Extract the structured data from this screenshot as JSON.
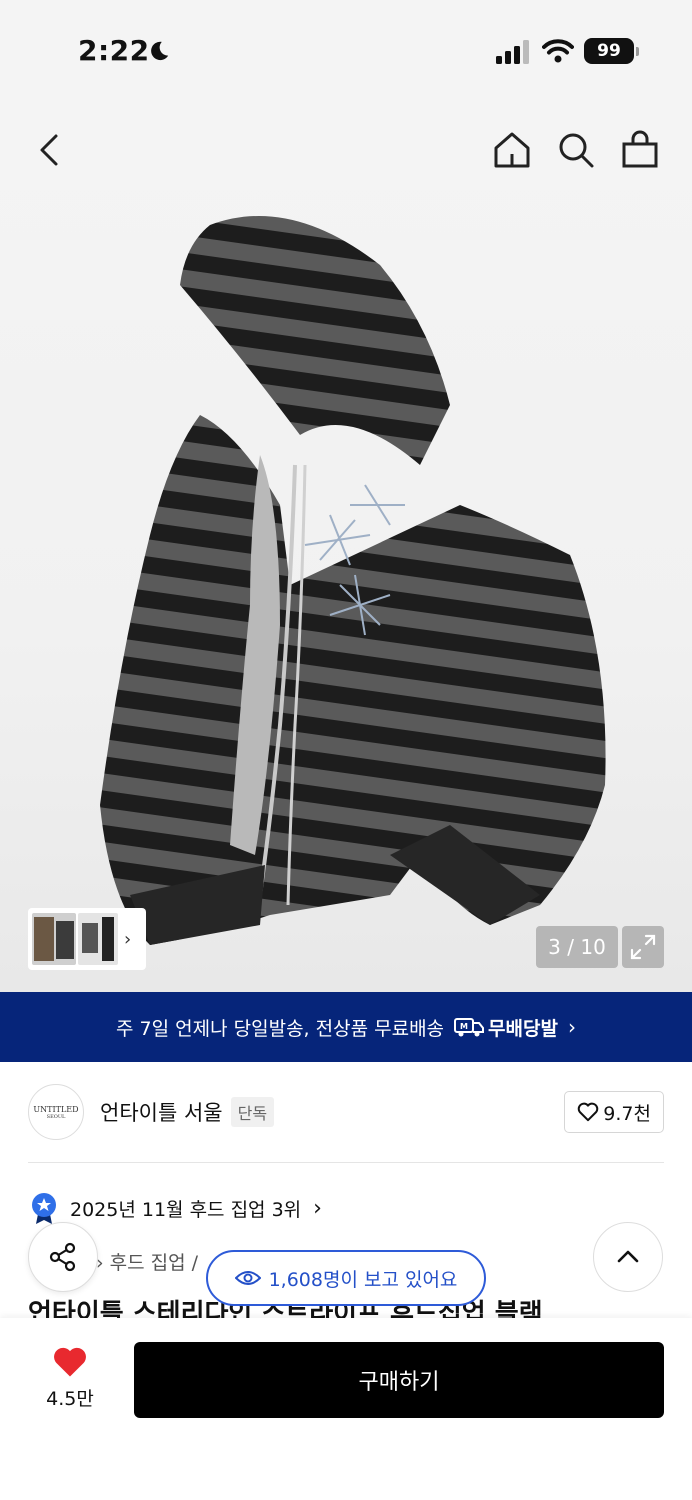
{
  "status_bar": {
    "time": "2:22",
    "battery": "99",
    "moon_icon": "moon-icon",
    "signal_icon": "cellular-signal-icon",
    "wifi_icon": "wifi-icon"
  },
  "header": {
    "back_icon": "back-chevron-icon",
    "home_icon": "home-icon",
    "search_icon": "search-icon",
    "cart_icon": "shopping-bag-icon"
  },
  "gallery": {
    "counter": "3 / 10",
    "thumbnail_arrow": "›"
  },
  "banner": {
    "text": "주 7일 언제나 당일발송, 전상품 무료배송",
    "badge": "무배당발",
    "badge_icon": "truck-icon",
    "background": "#06257a"
  },
  "brand": {
    "logo_text": "UNTITLED",
    "logo_subtext": "SEOUL",
    "name": "언타이틀 서울",
    "tag": "단독",
    "likes": "9.7천"
  },
  "ranking": {
    "text": "2025년 11월 후드 집업 3위",
    "arrow": "›"
  },
  "breadcrumb": {
    "text": "› 후드 집업 /"
  },
  "viewers": {
    "text": "1,608명이 보고 있어요"
  },
  "product": {
    "title_partial": "언타이틀 스테리다인 스트라이프 후드집업 블랙"
  },
  "bottom_bar": {
    "heart_count": "4.5만",
    "buy_label": "구매하기",
    "heart_color": "#e8292f"
  }
}
